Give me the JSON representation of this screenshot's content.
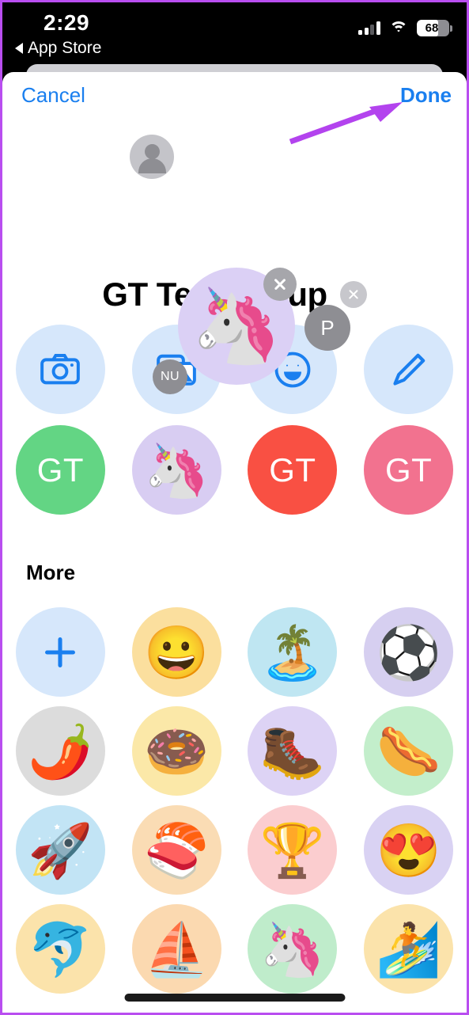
{
  "status_bar": {
    "time": "2:29",
    "back_label": "App Store",
    "back_icon": "triangle-left-icon",
    "signal_icon": "cellular-signal-icon",
    "wifi_icon": "wifi-icon",
    "battery_icon": "battery-icon",
    "battery_level": "68",
    "battery_percent": 68
  },
  "nav": {
    "cancel_label": "Cancel",
    "done_label": "Done",
    "accent_color": "#1a7fef"
  },
  "annotation": {
    "arrow_icon": "arrow-pointing-to-done-icon",
    "color": "#b343ee"
  },
  "avatar_cluster": {
    "main_avatar": {
      "emoji": "🦄",
      "background_color": "#dbd0f5",
      "remove_icon": "close-circle-icon"
    },
    "members": [
      {
        "name": "member-placeholder",
        "label": "",
        "icon": "person-icon",
        "background_color": "#c4c4c9"
      },
      {
        "name": "member-p",
        "label": "P",
        "background_color": "#8e8e93"
      },
      {
        "name": "member-nu",
        "label": "NU",
        "background_color": "#8e8e93"
      }
    ]
  },
  "title": {
    "text": "GT Test Group",
    "clear_icon": "clear-text-icon"
  },
  "actions": [
    {
      "name": "camera",
      "icon": "camera-icon",
      "background_color": "#d6e7fb",
      "tint": "#1a7fef"
    },
    {
      "name": "photos",
      "icon": "photos-icon",
      "background_color": "#d6e7fb",
      "tint": "#1a7fef"
    },
    {
      "name": "emoji",
      "icon": "smiley-icon",
      "background_color": "#d6e7fb",
      "tint": "#1a7fef"
    },
    {
      "name": "draw",
      "icon": "pencil-icon",
      "background_color": "#d6e7fb",
      "tint": "#1a7fef"
    }
  ],
  "presets": [
    {
      "name": "preset-green",
      "type": "monogram",
      "label": "GT",
      "emoji": "",
      "background_color": "#63d584"
    },
    {
      "name": "preset-unicorn",
      "type": "emoji",
      "label": "",
      "emoji": "🦄",
      "background_color": "#d8cdf2"
    },
    {
      "name": "preset-red",
      "type": "monogram",
      "label": "GT",
      "emoji": "",
      "background_color": "#f95043"
    },
    {
      "name": "preset-pink",
      "type": "monogram",
      "label": "GT",
      "emoji": "",
      "background_color": "#f2728f"
    }
  ],
  "more": {
    "heading": "More",
    "items": [
      {
        "name": "add-custom",
        "type": "add",
        "emoji": "",
        "icon": "plus-icon",
        "background_color": "#d6e7fb"
      },
      {
        "name": "grinning-face",
        "type": "emoji",
        "emoji": "😀",
        "background_color": "#fbdf9e"
      },
      {
        "name": "desert-island",
        "type": "emoji",
        "emoji": "🏝️",
        "background_color": "#bfe6f2"
      },
      {
        "name": "soccer-ball",
        "type": "emoji",
        "emoji": "⚽",
        "background_color": "#d6cff0"
      },
      {
        "name": "hot-pepper",
        "type": "emoji",
        "emoji": "🌶️",
        "background_color": "#dcdcdc"
      },
      {
        "name": "doughnut",
        "type": "emoji",
        "emoji": "🍩",
        "background_color": "#fbe8a8"
      },
      {
        "name": "hiking-boot",
        "type": "emoji",
        "emoji": "🥾",
        "background_color": "#ddd3f5"
      },
      {
        "name": "hot-dog",
        "type": "emoji",
        "emoji": "🌭",
        "background_color": "#c3eecb"
      },
      {
        "name": "rocket",
        "type": "emoji",
        "emoji": "🚀",
        "background_color": "#c2e4f5"
      },
      {
        "name": "sushi",
        "type": "emoji",
        "emoji": "🍣",
        "background_color": "#fadcb4"
      },
      {
        "name": "trophy",
        "type": "emoji",
        "emoji": "🏆",
        "background_color": "#fbcdcf"
      },
      {
        "name": "smiling-face-with-hearts",
        "type": "emoji",
        "emoji": "😍",
        "background_color": "#d9d2f3"
      },
      {
        "name": "dolphin",
        "type": "emoji",
        "emoji": "🐬",
        "background_color": "#fbe3ab"
      },
      {
        "name": "sailboat",
        "type": "emoji",
        "emoji": "⛵",
        "background_color": "#fbd9b0"
      },
      {
        "name": "unicorn",
        "type": "emoji",
        "emoji": "🦄",
        "background_color": "#bfeccb"
      },
      {
        "name": "surfer",
        "type": "emoji",
        "emoji": "🏄",
        "background_color": "#fbe3ab"
      }
    ]
  }
}
